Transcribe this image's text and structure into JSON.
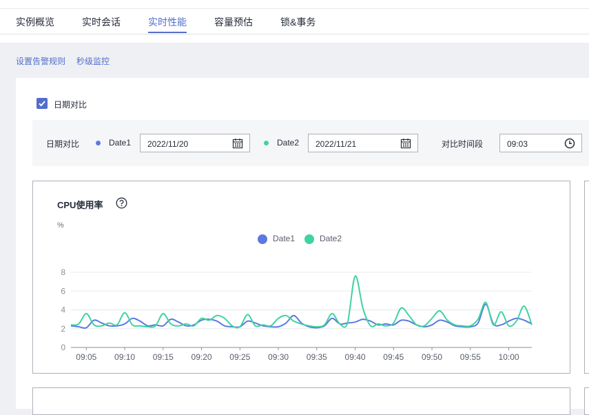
{
  "tabs": [
    {
      "label": "实例概览"
    },
    {
      "label": "实时会话"
    },
    {
      "label": "实时性能",
      "active": true
    },
    {
      "label": "容量预估"
    },
    {
      "label": "锁&事务"
    }
  ],
  "links": {
    "alert_rules": "设置告警规则",
    "second_monitor": "秒级监控"
  },
  "compare": {
    "checkbox_label": "日期对比",
    "checked": true,
    "filter_label": "日期对比",
    "date1_label": "Date1",
    "date1_value": "2022/11/20",
    "date2_label": "Date2",
    "date2_value": "2022/11/21",
    "time_label": "对比时间段",
    "time_value": "09:03"
  },
  "colors": {
    "accent": "#526ecc",
    "date1": "#5b79e0",
    "date2": "#3fd3a0"
  },
  "icons": {
    "checkbox": "check-icon",
    "date": "calendar-icon",
    "time": "clock-icon",
    "help": "question-circle-icon"
  },
  "cpu_chart": {
    "title": "CPU使用率",
    "unit": "%"
  },
  "chart_data": {
    "type": "line",
    "title": "CPU使用率",
    "ylabel": "%",
    "ylim": [
      0,
      8
    ],
    "yticks": [
      0,
      2,
      4,
      6,
      8
    ],
    "xlim": [
      "09:03",
      "10:03"
    ],
    "xticks": [
      "09:05",
      "09:10",
      "09:15",
      "09:20",
      "09:25",
      "09:30",
      "09:35",
      "09:40",
      "09:45",
      "09:50",
      "09:55",
      "10:00"
    ],
    "grid": true,
    "legend": "top-center",
    "x": [
      "09:03",
      "09:04",
      "09:05",
      "09:06",
      "09:07",
      "09:08",
      "09:09",
      "09:10",
      "09:11",
      "09:12",
      "09:13",
      "09:14",
      "09:15",
      "09:16",
      "09:17",
      "09:18",
      "09:19",
      "09:20",
      "09:21",
      "09:22",
      "09:23",
      "09:24",
      "09:25",
      "09:26",
      "09:27",
      "09:28",
      "09:29",
      "09:30",
      "09:31",
      "09:32",
      "09:33",
      "09:34",
      "09:35",
      "09:36",
      "09:37",
      "09:38",
      "09:39",
      "09:40",
      "09:41",
      "09:42",
      "09:43",
      "09:44",
      "09:45",
      "09:46",
      "09:47",
      "09:48",
      "09:49",
      "09:50",
      "09:51",
      "09:52",
      "09:53",
      "09:54",
      "09:55",
      "09:56",
      "09:57",
      "09:58",
      "09:59",
      "10:00",
      "10:01",
      "10:02",
      "10:03"
    ],
    "series": [
      {
        "name": "Date1",
        "values": [
          2.3,
          2.2,
          2.1,
          2.9,
          2.6,
          2.3,
          2.3,
          2.5,
          3.1,
          2.8,
          2.3,
          2.4,
          2.3,
          3.0,
          2.7,
          2.3,
          2.4,
          2.9,
          3.0,
          2.8,
          2.3,
          2.2,
          2.2,
          2.8,
          2.6,
          2.3,
          2.2,
          2.2,
          2.6,
          3.4,
          2.6,
          2.2,
          2.1,
          2.3,
          3.1,
          2.5,
          2.6,
          2.7,
          3.0,
          2.8,
          2.4,
          2.5,
          2.4,
          2.9,
          2.8,
          2.4,
          2.2,
          2.4,
          2.9,
          2.7,
          2.3,
          2.2,
          2.2,
          2.6,
          4.6,
          2.5,
          2.4,
          2.8,
          3.1,
          2.9,
          2.5
        ]
      },
      {
        "name": "Date2",
        "values": [
          2.4,
          2.5,
          3.6,
          2.4,
          2.3,
          2.6,
          2.4,
          3.7,
          2.4,
          2.3,
          2.2,
          2.3,
          3.6,
          2.5,
          2.3,
          2.5,
          2.3,
          3.1,
          2.9,
          3.4,
          3.1,
          2.3,
          2.2,
          3.5,
          2.3,
          2.4,
          2.3,
          3.1,
          3.4,
          2.8,
          2.5,
          2.3,
          2.2,
          2.4,
          3.6,
          2.5,
          2.6,
          7.6,
          4.2,
          2.3,
          2.5,
          2.3,
          2.6,
          4.2,
          3.4,
          2.4,
          2.3,
          3.1,
          3.9,
          2.9,
          2.4,
          2.3,
          2.3,
          3.0,
          4.8,
          2.4,
          3.8,
          2.3,
          2.8,
          4.4,
          2.4
        ]
      }
    ]
  }
}
